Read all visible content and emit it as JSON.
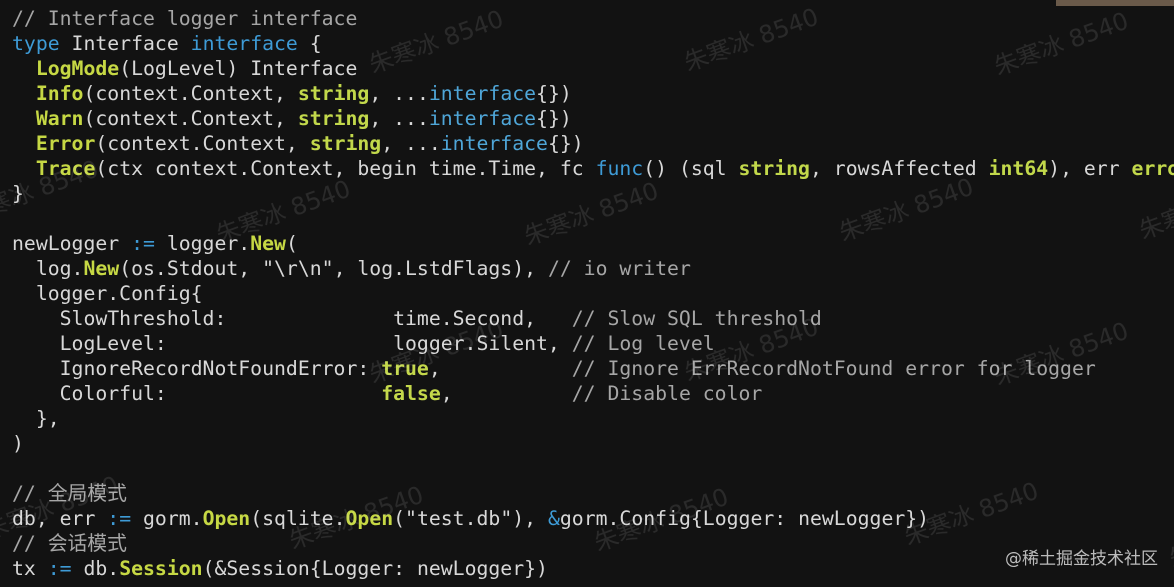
{
  "code_lines": [
    [
      {
        "t": "// Interface logger interface",
        "k": "comment"
      }
    ],
    [
      {
        "t": "type",
        "k": "keyword"
      },
      {
        "t": " Interface ",
        "k": "plain"
      },
      {
        "t": "interface",
        "k": "keyword"
      },
      {
        "t": " {",
        "k": "plain"
      }
    ],
    [
      {
        "t": "  ",
        "k": "plain"
      },
      {
        "t": "LogMode",
        "k": "func"
      },
      {
        "t": "(LogLevel) Interface",
        "k": "plain"
      }
    ],
    [
      {
        "t": "  ",
        "k": "plain"
      },
      {
        "t": "Info",
        "k": "func"
      },
      {
        "t": "(context.Context, ",
        "k": "plain"
      },
      {
        "t": "string",
        "k": "type"
      },
      {
        "t": ", ...",
        "k": "plain"
      },
      {
        "t": "interface",
        "k": "iface"
      },
      {
        "t": "{})",
        "k": "plain"
      }
    ],
    [
      {
        "t": "  ",
        "k": "plain"
      },
      {
        "t": "Warn",
        "k": "func"
      },
      {
        "t": "(context.Context, ",
        "k": "plain"
      },
      {
        "t": "string",
        "k": "type"
      },
      {
        "t": ", ...",
        "k": "plain"
      },
      {
        "t": "interface",
        "k": "iface"
      },
      {
        "t": "{})",
        "k": "plain"
      }
    ],
    [
      {
        "t": "  ",
        "k": "plain"
      },
      {
        "t": "Error",
        "k": "func"
      },
      {
        "t": "(context.Context, ",
        "k": "plain"
      },
      {
        "t": "string",
        "k": "type"
      },
      {
        "t": ", ...",
        "k": "plain"
      },
      {
        "t": "interface",
        "k": "iface"
      },
      {
        "t": "{})",
        "k": "plain"
      }
    ],
    [
      {
        "t": "  ",
        "k": "plain"
      },
      {
        "t": "Trace",
        "k": "func"
      },
      {
        "t": "(ctx context.Context, begin time.Time, fc ",
        "k": "plain"
      },
      {
        "t": "func",
        "k": "keyword"
      },
      {
        "t": "() (sql ",
        "k": "plain"
      },
      {
        "t": "string",
        "k": "type"
      },
      {
        "t": ", rowsAffected ",
        "k": "plain"
      },
      {
        "t": "int64",
        "k": "type"
      },
      {
        "t": "), err ",
        "k": "plain"
      },
      {
        "t": "error",
        "k": "type"
      },
      {
        "t": ")",
        "k": "plain"
      }
    ],
    [
      {
        "t": "}",
        "k": "plain"
      }
    ],
    [
      {
        "t": "",
        "k": "plain"
      }
    ],
    [
      {
        "t": "newLogger ",
        "k": "plain"
      },
      {
        "t": ":=",
        "k": "op"
      },
      {
        "t": " logger.",
        "k": "plain"
      },
      {
        "t": "New",
        "k": "func"
      },
      {
        "t": "(",
        "k": "plain"
      }
    ],
    [
      {
        "t": "  log.",
        "k": "plain"
      },
      {
        "t": "New",
        "k": "func"
      },
      {
        "t": "(os.Stdout, \"\\r\\n\", log.LstdFlags), ",
        "k": "plain"
      },
      {
        "t": "// io writer",
        "k": "comment"
      }
    ],
    [
      {
        "t": "  logger.Config{",
        "k": "plain"
      }
    ],
    [
      {
        "t": "    SlowThreshold:              time.Second,   ",
        "k": "plain"
      },
      {
        "t": "// Slow SQL threshold",
        "k": "comment"
      }
    ],
    [
      {
        "t": "    LogLevel:                   logger.Silent, ",
        "k": "plain"
      },
      {
        "t": "// Log level",
        "k": "comment"
      }
    ],
    [
      {
        "t": "    IgnoreRecordNotFoundError: ",
        "k": "plain"
      },
      {
        "t": "true",
        "k": "literal"
      },
      {
        "t": ",           ",
        "k": "plain"
      },
      {
        "t": "// Ignore ErrRecordNotFound error for logger",
        "k": "comment"
      }
    ],
    [
      {
        "t": "    Colorful:                  ",
        "k": "plain"
      },
      {
        "t": "false",
        "k": "literal"
      },
      {
        "t": ",          ",
        "k": "plain"
      },
      {
        "t": "// Disable color",
        "k": "comment"
      }
    ],
    [
      {
        "t": "  },",
        "k": "plain"
      }
    ],
    [
      {
        "t": ")",
        "k": "plain"
      }
    ],
    [
      {
        "t": "",
        "k": "plain"
      }
    ],
    [
      {
        "t": "// 全局模式",
        "k": "comment"
      }
    ],
    [
      {
        "t": "db, err ",
        "k": "plain"
      },
      {
        "t": ":=",
        "k": "op"
      },
      {
        "t": " gorm.",
        "k": "plain"
      },
      {
        "t": "Open",
        "k": "func"
      },
      {
        "t": "(sqlite.",
        "k": "plain"
      },
      {
        "t": "Open",
        "k": "func"
      },
      {
        "t": "(\"test.db\"), ",
        "k": "plain"
      },
      {
        "t": "&",
        "k": "op"
      },
      {
        "t": "gorm.Config{Logger: newLogger})",
        "k": "plain"
      }
    ],
    [
      {
        "t": "// 会话模式",
        "k": "comment"
      }
    ],
    [
      {
        "t": "tx ",
        "k": "plain"
      },
      {
        "t": ":=",
        "k": "op"
      },
      {
        "t": " db.",
        "k": "plain"
      },
      {
        "t": "Session",
        "k": "func"
      },
      {
        "t": "(&Session{Logger: newLogger})",
        "k": "plain"
      }
    ]
  ],
  "watermarks": [
    "朱寒冰 8540"
  ],
  "brand_text": "@稀土掘金技术社区",
  "colors": {
    "background": "#121212",
    "text": "#d8d8d8",
    "comment": "#a6a6a6",
    "keyword": "#3e9bd6",
    "accent_green": "#c2d84b"
  }
}
